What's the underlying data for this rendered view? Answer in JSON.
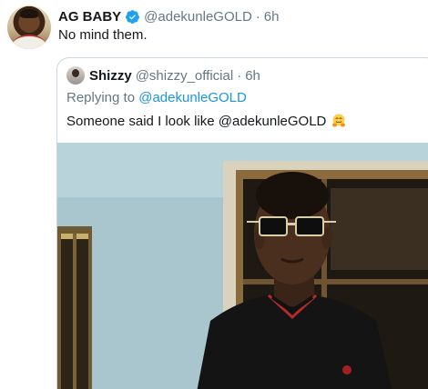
{
  "tweet": {
    "name": "AG BABY",
    "handle": "@adekunleGOLD",
    "separator": "·",
    "time": "6h",
    "text": "No mind them.",
    "verified_color": "#1da1f2"
  },
  "quoted_tweet": {
    "name": "Shizzy",
    "handle": "@shizzy_official",
    "separator": "·",
    "time": "6h",
    "replying_prefix": "Replying to",
    "replying_to": "@adekunleGOLD",
    "text": "Someone said I look like @adekunleGOLD",
    "emoji": "hugging-face"
  },
  "colors": {
    "text_primary": "#14171a",
    "text_secondary": "#657786",
    "link": "#1b95e0",
    "border": "#ccd6dd"
  }
}
